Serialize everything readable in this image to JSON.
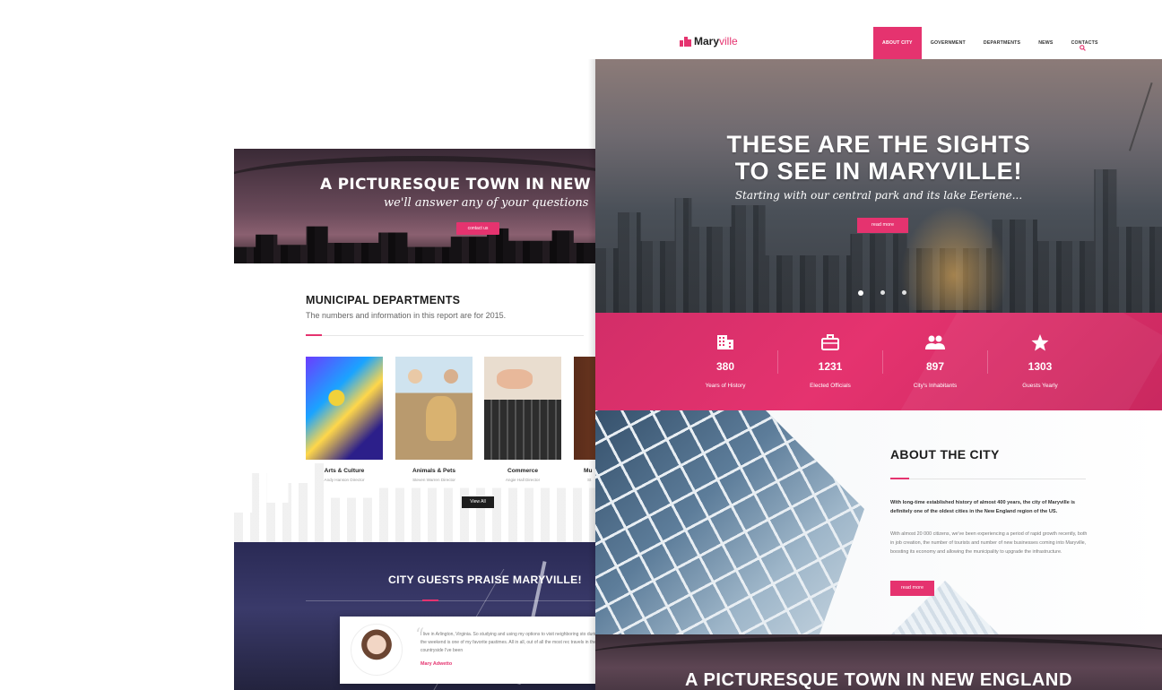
{
  "back_page": {
    "hero": {
      "title": "A PICTURESQUE TOWN IN NEW ENG",
      "subtitle": "we'll answer any of your questions",
      "button": "contact us"
    },
    "departments": {
      "title": "MUNICIPAL DEPARTMENTS",
      "subtitle": "The numbers and information in this report are for 2015.",
      "cards": [
        {
          "name": "Arts & Culture",
          "role": "Andy Hanson Director"
        },
        {
          "name": "Animals & Pets",
          "role": "Steven Warren Director"
        },
        {
          "name": "Commerce",
          "role": "Angie Hall Director"
        },
        {
          "name": "Mu",
          "role": "St"
        }
      ],
      "view_all": "View All"
    },
    "praise": {
      "title": "CITY GUESTS PRAISE MARYVILLE!",
      "quote": "I live in Arlington, Virginia. So studying and using my options to visit neighboring sto during the weekend is one of my favorite pastimes. All in all, out of all the most rec travels in the countryside I've been",
      "author": "Mary Adwetto"
    }
  },
  "front_page": {
    "logo": {
      "part1": "Mary",
      "part2": "ville",
      "icon": "city-buildings-icon"
    },
    "nav": [
      "ABOUT CITY",
      "GOVERNMENT",
      "DEPARTMENTS",
      "NEWS",
      "CONTACTS"
    ],
    "nav_active": "ABOUT CITY",
    "search_icon": "search-icon",
    "hero": {
      "line1": "THESE ARE THE SIGHTS",
      "line2": "TO SEE IN MARYVILLE!",
      "subtitle": "Starting with our central park and its lake Eeriene...",
      "button": "read more",
      "slides": 3,
      "active_slide": 1
    },
    "stats": [
      {
        "icon": "building-icon",
        "value": "380",
        "label": "Years of History"
      },
      {
        "icon": "briefcase-icon",
        "value": "1231",
        "label": "Elected Officials"
      },
      {
        "icon": "people-icon",
        "value": "897",
        "label": "City's Inhabitants"
      },
      {
        "icon": "star-icon",
        "value": "1303",
        "label": "Guests Yearly"
      }
    ],
    "about": {
      "title": "ABOUT THE CITY",
      "p1": "With long-time established history of almost 400 years, the city of Maryville is definitely one of the oldest cities in the New England region of the US.",
      "p2": "With almost 20 000 citizens, we've been experiencing a period of rapid growth recently, both in job creation, the number of tourists and number of new businesses coming into Maryville, boosting its economy and allowing the municipality to upgrade the infrastructure.",
      "button": "read more"
    },
    "bottom_title": "A PICTURESQUE TOWN IN NEW ENGLAND"
  },
  "colors": {
    "accent": "#e5336f",
    "dark": "#1e1e1e",
    "navy": "#2a2a55"
  }
}
